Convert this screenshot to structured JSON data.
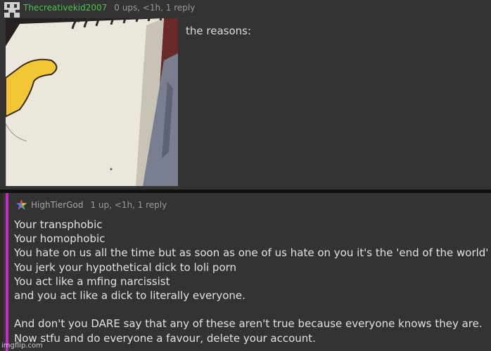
{
  "comment1": {
    "username": "Thecreativekid2007",
    "stats": "0 ups, <1h, 1 reply",
    "body": "the reasons:",
    "image": {
      "subject": "notepad-meme"
    }
  },
  "comment2": {
    "username": "HighTierGod",
    "stats": "1 up, <1h, 1 reply",
    "lines": [
      "Your transphobic",
      "Your homophobic",
      "You hate on us all the time but as soon as one of us hate on you it's the 'end of the world'",
      "You jerk your hypothetical dick to loli porn",
      "You act like a mfing narcissist",
      "and you act like a dick to literally everyone.",
      "",
      "And don't you DARE say that any of these aren't true because everyone knows they are.",
      "Now stfu and do everyone a favour, delete your account."
    ],
    "thread_color": "#c62ac6"
  },
  "colors": {
    "background": "#333333",
    "username_green": "#4ec24e",
    "meta_gray": "#9a9a9a"
  },
  "watermark": "imgflip.com"
}
